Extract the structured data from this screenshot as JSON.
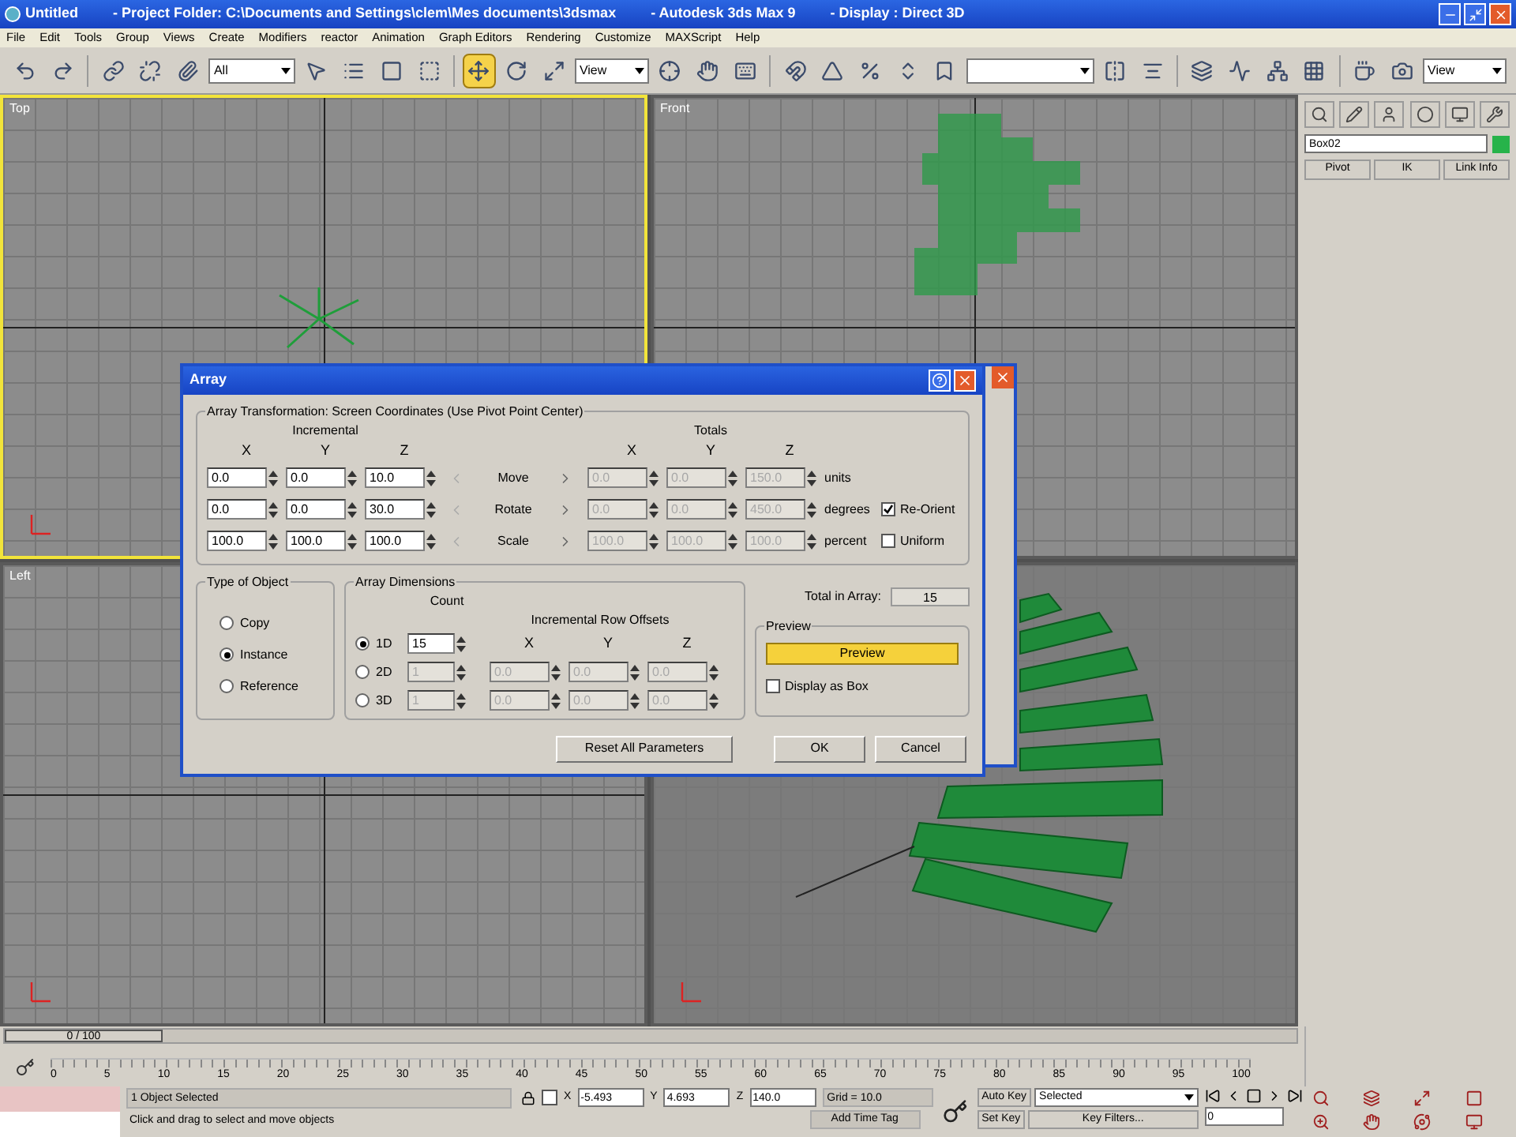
{
  "window": {
    "title_parts": [
      "Untitled",
      "- Project Folder: C:\\Documents and Settings\\clem\\Mes documents\\3dsmax",
      "- Autodesk 3ds Max 9",
      "- Display : Direct 3D"
    ]
  },
  "menu": [
    "File",
    "Edit",
    "Tools",
    "Group",
    "Views",
    "Create",
    "Modifiers",
    "reactor",
    "Animation",
    "Graph Editors",
    "Rendering",
    "Customize",
    "MAXScript",
    "Help"
  ],
  "toolbar": {
    "selection_filter": "All",
    "reference_coordinate": "View",
    "render_view": "View",
    "tools": [
      {
        "selected": false
      },
      {
        "selected": false
      },
      {
        "selected": false
      },
      {
        "selected": false
      },
      {
        "selected": false
      },
      {
        "selected": false
      },
      {
        "selected": false
      },
      {
        "selected": false
      },
      {
        "selected": false
      },
      {
        "selected": true
      },
      {
        "selected": false
      },
      {
        "selected": false
      },
      {
        "selected": false
      },
      {
        "selected": false
      },
      {
        "selected": false
      },
      {
        "selected": false
      },
      {
        "selected": false
      },
      {
        "selected": false
      },
      {
        "selected": false
      },
      {
        "selected": false
      },
      {
        "selected": false
      },
      {
        "selected": false
      },
      {
        "selected": false
      },
      {
        "selected": false
      },
      {
        "selected": false
      },
      {
        "selected": false
      },
      {
        "selected": false
      },
      {
        "selected": false
      }
    ]
  },
  "viewports": [
    {
      "kind": "top",
      "label": "Top",
      "active": true
    },
    {
      "kind": "front",
      "label": "Front",
      "active": false
    },
    {
      "kind": "left",
      "label": "Left",
      "active": false
    },
    {
      "kind": "perspective",
      "active": false
    }
  ],
  "command_panel": {
    "object_name": "Box02",
    "buttons": [
      "Pivot",
      "IK",
      "Link Info"
    ]
  },
  "dialog": {
    "title": "Array",
    "transformation": {
      "title": "Array Transformation: Screen Coordinates (Use Pivot Point Center)",
      "incremental_label": "Incremental",
      "totals_label": "Totals",
      "incremental_axes": [
        "X",
        "Y",
        "Z"
      ],
      "totals_axes": [
        "X",
        "Y",
        "Z"
      ],
      "rows": [
        {
          "label": "Move",
          "incremental": [
            "0.0",
            "0.0",
            "10.0"
          ],
          "totals": [
            "0.0",
            "0.0",
            "150.0"
          ],
          "unit": "units"
        },
        {
          "label": "Rotate",
          "incremental": [
            "0.0",
            "0.0",
            "30.0"
          ],
          "totals": [
            "0.0",
            "0.0",
            "450.0"
          ],
          "unit": "degrees",
          "option": {
            "label": "Re-Orient",
            "checked": true
          }
        },
        {
          "label": "Scale",
          "incremental": [
            "100.0",
            "100.0",
            "100.0"
          ],
          "totals": [
            "100.0",
            "100.0",
            "100.0"
          ],
          "unit": "percent",
          "option": {
            "label": "Uniform",
            "checked": false
          }
        }
      ]
    },
    "type_of_object": {
      "title": "Type of Object",
      "options": [
        {
          "label": "Copy",
          "selected": false
        },
        {
          "label": "Instance",
          "selected": true
        },
        {
          "label": "Reference",
          "selected": false
        }
      ]
    },
    "dimensions": {
      "title": "Array Dimensions",
      "count_label": "Count",
      "offsets_label": "Incremental Row Offsets",
      "axes": [
        "X",
        "Y",
        "Z"
      ],
      "rows": [
        {
          "label": "1D",
          "selected": true,
          "disabled": false,
          "count": "15"
        },
        {
          "label": "2D",
          "selected": false,
          "disabled": true,
          "count": "1",
          "offsets": [
            "0.0",
            "0.0",
            "0.0"
          ]
        },
        {
          "label": "3D",
          "selected": false,
          "disabled": true,
          "count": "1",
          "offsets": [
            "0.0",
            "0.0",
            "0.0"
          ]
        }
      ]
    },
    "total_label": "Total in Array:",
    "total_value": "15",
    "preview": {
      "title": "Preview",
      "button": "Preview",
      "on": true,
      "display_as_box": {
        "label": "Display as Box",
        "checked": false
      }
    },
    "buttons": [
      "Reset All Parameters",
      "OK",
      "Cancel"
    ]
  },
  "timeline": {
    "frame": "0 / 100",
    "ticks": [
      "0",
      "5",
      "10",
      "15",
      "20",
      "25",
      "30",
      "35",
      "40",
      "45",
      "50",
      "55",
      "60",
      "65",
      "70",
      "75",
      "80",
      "85",
      "90",
      "95",
      "100"
    ]
  },
  "status": {
    "selection": "1 Object Selected",
    "prompt": "Click and drag to select and move objects",
    "coordinates": [
      {
        "label": "X",
        "value": "-5.493"
      },
      {
        "label": "Y",
        "value": "4.693"
      },
      {
        "label": "Z",
        "value": "140.0"
      }
    ],
    "grid": "Grid = 10.0",
    "time_tag": "Add Time Tag",
    "auto_key": "Auto Key",
    "key_mode": "Selected",
    "set_key": "Set Key",
    "key_filters": "Key Filters...",
    "current_frame": "0"
  }
}
